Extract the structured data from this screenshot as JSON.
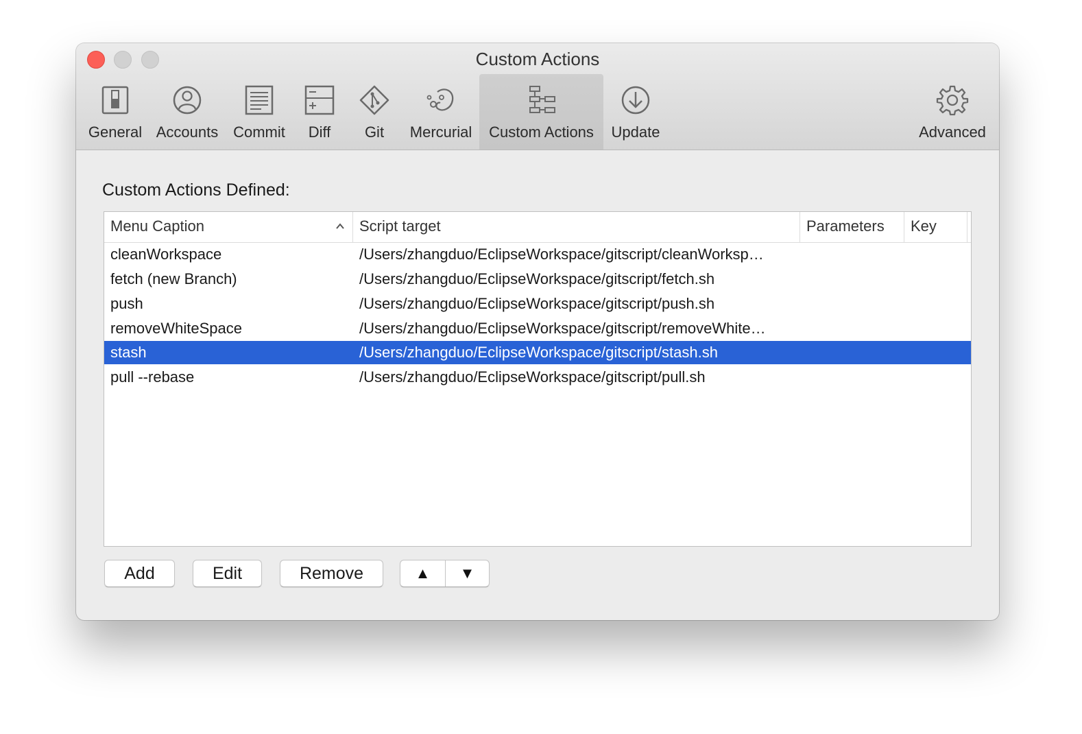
{
  "window": {
    "title": "Custom Actions"
  },
  "toolbar": {
    "items": [
      {
        "label": "General",
        "icon": "general-icon"
      },
      {
        "label": "Accounts",
        "icon": "accounts-icon"
      },
      {
        "label": "Commit",
        "icon": "commit-icon"
      },
      {
        "label": "Diff",
        "icon": "diff-icon"
      },
      {
        "label": "Git",
        "icon": "git-icon"
      },
      {
        "label": "Mercurial",
        "icon": "mercurial-icon"
      },
      {
        "label": "Custom Actions",
        "icon": "custom-actions-icon",
        "selected": true
      },
      {
        "label": "Update",
        "icon": "update-icon"
      },
      {
        "label": "Advanced",
        "icon": "gear-icon"
      }
    ]
  },
  "content": {
    "section_label": "Custom Actions Defined:",
    "table": {
      "columns": [
        "Menu Caption",
        "Script target",
        "Parameters",
        "Key"
      ],
      "sorted_column": "Menu Caption",
      "sort_direction": "ascending",
      "rows": [
        {
          "caption": "cleanWorkspace",
          "script": "/Users/zhangduo/EclipseWorkspace/gitscript/cleanWorksp…",
          "parameters": "",
          "key": ""
        },
        {
          "caption": "fetch (new Branch)",
          "script": "/Users/zhangduo/EclipseWorkspace/gitscript/fetch.sh",
          "parameters": "",
          "key": ""
        },
        {
          "caption": "push",
          "script": "/Users/zhangduo/EclipseWorkspace/gitscript/push.sh",
          "parameters": "",
          "key": ""
        },
        {
          "caption": "removeWhiteSpace",
          "script": "/Users/zhangduo/EclipseWorkspace/gitscript/removeWhite…",
          "parameters": "",
          "key": ""
        },
        {
          "caption": "stash",
          "script": "/Users/zhangduo/EclipseWorkspace/gitscript/stash.sh",
          "parameters": "",
          "key": "",
          "selected": true
        },
        {
          "caption": "pull --rebase",
          "script": "/Users/zhangduo/EclipseWorkspace/gitscript/pull.sh",
          "parameters": "",
          "key": ""
        }
      ]
    },
    "buttons": {
      "add": "Add",
      "edit": "Edit",
      "remove": "Remove",
      "move_up": "▲",
      "move_down": "▼"
    }
  },
  "colors": {
    "selection": "#2962d6",
    "close_button": "#fc5f57",
    "window_background": "#ececec"
  }
}
